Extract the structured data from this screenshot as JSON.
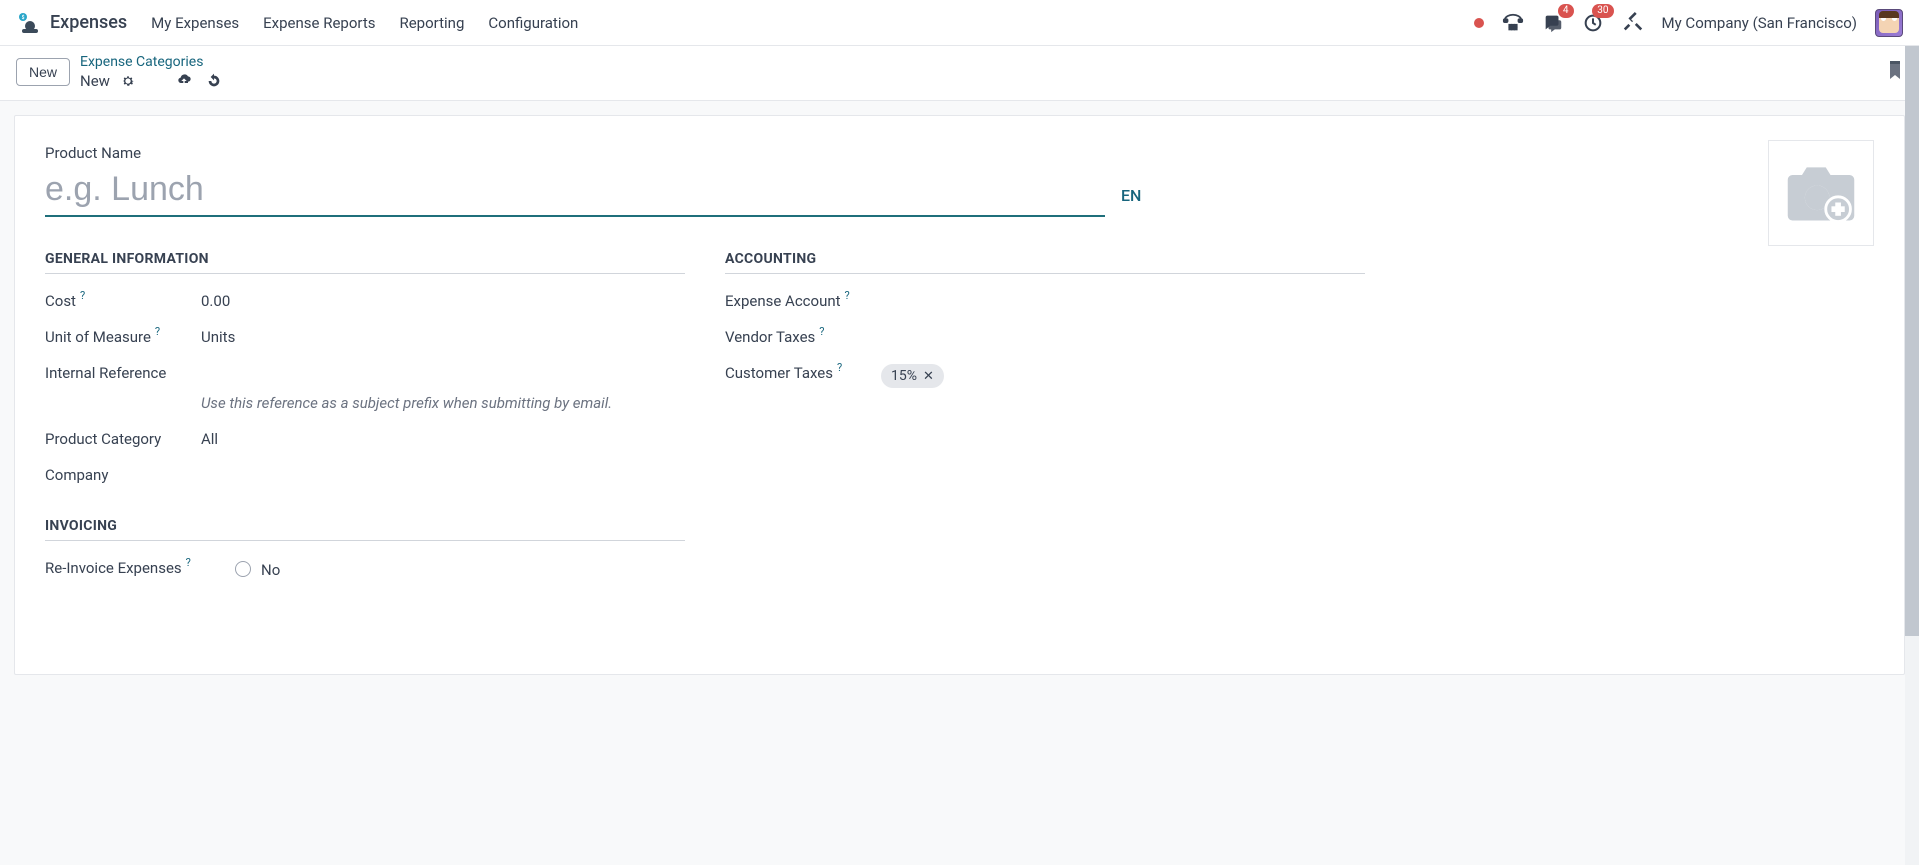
{
  "app": {
    "title": "Expenses",
    "menu": [
      "My Expenses",
      "Expense Reports",
      "Reporting",
      "Configuration"
    ],
    "company": "My Company (San Francisco)",
    "badges": {
      "messages": "4",
      "activities": "30"
    }
  },
  "breadcrumb": {
    "parent": "Expense Categories",
    "current": "New",
    "new_button": "New"
  },
  "form": {
    "product_name_label": "Product Name",
    "product_name_placeholder": "e.g. Lunch",
    "product_name_value": "",
    "lang": "EN",
    "sections": {
      "general": {
        "title": "GENERAL INFORMATION",
        "cost_label": "Cost",
        "cost_value": "0.00",
        "uom_label": "Unit of Measure",
        "uom_value": "Units",
        "internal_ref_label": "Internal Reference",
        "internal_ref_hint": "Use this reference as a subject prefix when submitting by email.",
        "category_label": "Product Category",
        "category_value": "All",
        "company_label": "Company",
        "company_value": ""
      },
      "accounting": {
        "title": "ACCOUNTING",
        "expense_account_label": "Expense Account",
        "vendor_taxes_label": "Vendor Taxes",
        "customer_taxes_label": "Customer Taxes",
        "customer_taxes_tag": "15%"
      },
      "invoicing": {
        "title": "INVOICING",
        "reinvoice_label": "Re-Invoice Expenses",
        "reinvoice_value": "No"
      }
    }
  }
}
